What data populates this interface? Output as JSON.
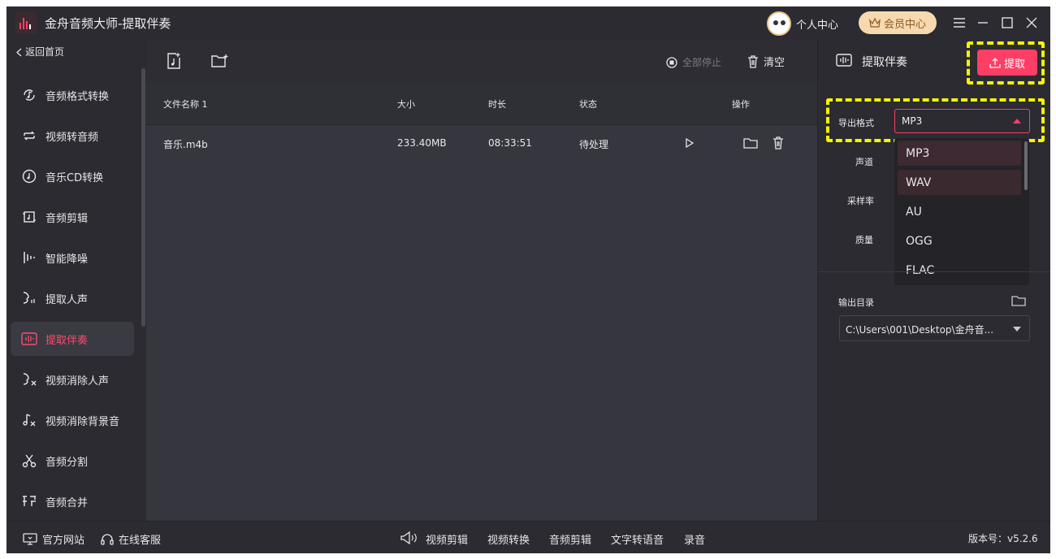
{
  "app": {
    "title": "金舟音频大师-提取伴奏",
    "personal_center": "个人中心",
    "vip_center": "会员中心"
  },
  "sidebar": {
    "back_label": "返回首页",
    "items": [
      {
        "label": "音频格式转换",
        "icon": "music-convert-icon"
      },
      {
        "label": "视频转音频",
        "icon": "video-to-audio-icon"
      },
      {
        "label": "音乐CD转换",
        "icon": "cd-icon"
      },
      {
        "label": "音频剪辑",
        "icon": "audio-cut-icon"
      },
      {
        "label": "智能降噪",
        "icon": "denoise-icon"
      },
      {
        "label": "提取人声",
        "icon": "voice-extract-icon"
      },
      {
        "label": "提取伴奏",
        "icon": "accompaniment-icon",
        "active": true
      },
      {
        "label": "视频消除人声",
        "icon": "video-remove-voice-icon"
      },
      {
        "label": "视频消除背景音",
        "icon": "video-remove-bg-icon"
      },
      {
        "label": "音频分割",
        "icon": "scissors-icon"
      },
      {
        "label": "音频合并",
        "icon": "merge-icon"
      }
    ]
  },
  "toolbar": {
    "stop_all": "全部停止",
    "clear": "清空"
  },
  "table": {
    "columns": [
      "文件名称 1",
      "大小",
      "时长",
      "状态",
      "操作"
    ],
    "rows": [
      {
        "name": "音乐.m4b",
        "size": "233.40MB",
        "duration": "08:33:51",
        "status": "待处理"
      }
    ]
  },
  "panel": {
    "title": "提取伴奏",
    "extract_button": "提取",
    "format_label": "导出格式",
    "format_value": "MP3",
    "channel_label": "声道",
    "sample_rate_label": "采样率",
    "quality_label": "质量",
    "format_options": [
      "MP3",
      "WAV",
      "AU",
      "OGG",
      "FLAC"
    ],
    "output_dir_label": "输出目录",
    "output_dir_value": "C:\\Users\\001\\Desktop\\金舟音..."
  },
  "footer": {
    "official_site": "官方网站",
    "online_service": "在线客服",
    "links": [
      "视频剪辑",
      "视频转换",
      "音频剪辑",
      "文字转语音",
      "录音"
    ],
    "version": "版本号：v5.2.6"
  },
  "colors": {
    "accent": "#ff3e66",
    "highlight": "#f5f500",
    "vip_bg": "#f7d9b0"
  }
}
